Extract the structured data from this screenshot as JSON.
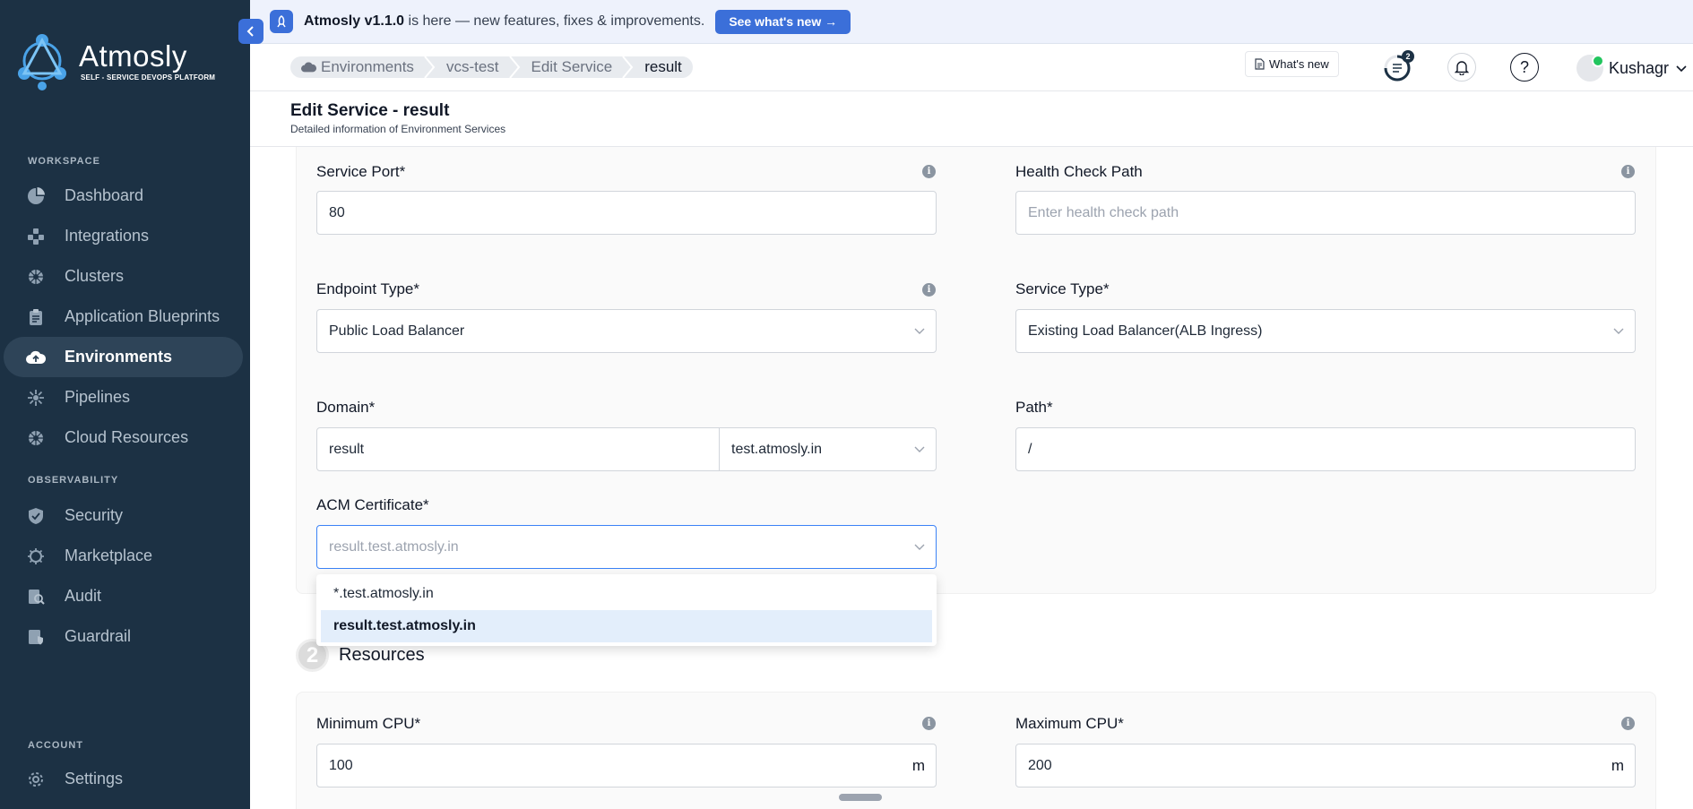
{
  "brand": {
    "name": "Atmosly",
    "tagline": "SELF - SERVICE DEVOPS PLATFORM"
  },
  "sidebar": {
    "workspace_label": "WORKSPACE",
    "observability_label": "OBSERVABILITY",
    "account_label": "ACCOUNT",
    "items": [
      {
        "label": "Dashboard",
        "icon": "pie-chart-icon"
      },
      {
        "label": "Integrations",
        "icon": "puzzle-icon"
      },
      {
        "label": "Clusters",
        "icon": "helm-icon"
      },
      {
        "label": "Application Blueprints",
        "icon": "clipboard-icon"
      },
      {
        "label": "Environments",
        "icon": "cloud-upload-icon",
        "active": true
      },
      {
        "label": "Pipelines",
        "icon": "pipeline-icon"
      },
      {
        "label": "Cloud Resources",
        "icon": "helm-icon"
      },
      {
        "label": "Security",
        "icon": "shield-icon"
      },
      {
        "label": "Marketplace",
        "icon": "helm-gear-icon"
      },
      {
        "label": "Audit",
        "icon": "audit-icon"
      },
      {
        "label": "Guardrail",
        "icon": "guardrail-icon"
      },
      {
        "label": "Settings",
        "icon": "gear-icon"
      }
    ]
  },
  "banner": {
    "version_text": "Atmosly v1.1.0",
    "message": " is here — new features, fixes & improvements.",
    "button_label": "See what's new →"
  },
  "header": {
    "breadcrumb": [
      "Environments",
      "vcs-test",
      "Edit Service",
      "result"
    ],
    "whats_new_label": "What's new",
    "task_badge": "2",
    "user_name": "Kushagr"
  },
  "page": {
    "title": "Edit Service - result",
    "subtitle": "Detailed information of Environment Services"
  },
  "form": {
    "service_port": {
      "label": "Service Port*",
      "value": "80"
    },
    "health_check_path": {
      "label": "Health Check Path",
      "placeholder": "Enter health check path"
    },
    "endpoint_type": {
      "label": "Endpoint Type*",
      "value": "Public Load Balancer"
    },
    "service_type": {
      "label": "Service Type*",
      "value": "Existing Load Balancer(ALB Ingress)"
    },
    "domain": {
      "label": "Domain*",
      "value": "result",
      "suffix": "test.atmosly.in"
    },
    "path": {
      "label": "Path*",
      "value": "/"
    },
    "acm_certificate": {
      "label": "ACM Certificate*",
      "placeholder": "result.test.atmosly.in",
      "options": [
        "*.test.atmosly.in",
        "result.test.atmosly.in"
      ],
      "highlighted_option": "result.test.atmosly.in"
    }
  },
  "resources": {
    "section_number": "2",
    "section_title": "Resources",
    "min_cpu": {
      "label": "Minimum CPU*",
      "value": "100",
      "unit": "m"
    },
    "max_cpu": {
      "label": "Maximum CPU*",
      "value": "200",
      "unit": "m"
    }
  },
  "colors": {
    "sidebar_bg": "#1c3144",
    "accent": "#3b6fd9",
    "selected_option_bg": "#e3eefb"
  }
}
